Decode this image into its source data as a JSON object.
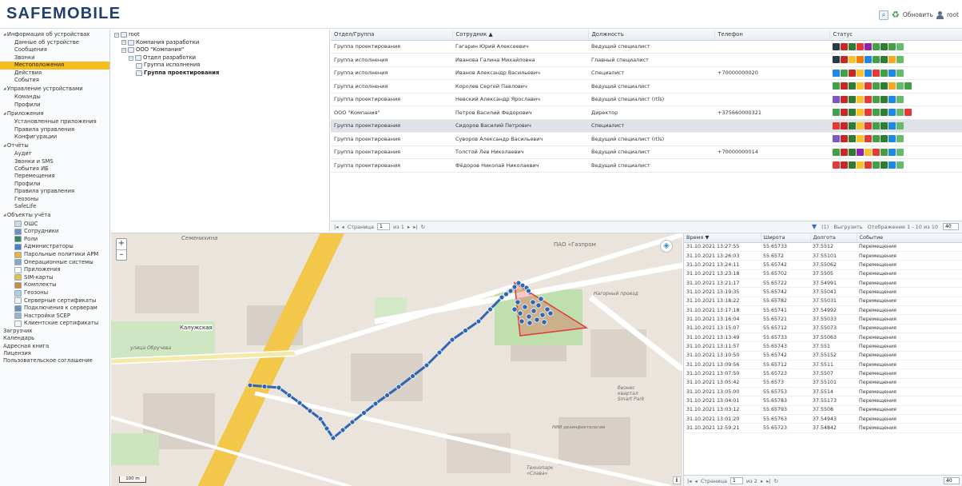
{
  "header": {
    "logo": "SAFEMOBILE",
    "refresh_label": "Обновить",
    "user": "root"
  },
  "sidebar": {
    "sections": [
      {
        "title": "Информация об устройствах",
        "items": [
          "Данные об устройстве",
          "Сообщения",
          "Звонки",
          "Местоположения",
          "Действия",
          "События"
        ],
        "active": "Местоположения"
      },
      {
        "title": "Управление устройствами",
        "items": [
          "Команды",
          "Профили"
        ]
      },
      {
        "title": "Приложения",
        "items": [
          "Установленные приложения",
          "Правила управления",
          "Конфигурации"
        ]
      },
      {
        "title": "Отчёты",
        "items": [
          "Аудит",
          "Звонки и SMS",
          "События ИБ",
          "Перемещения",
          "Профили",
          "Правила управления",
          "Геозоны",
          "SafeLife"
        ]
      },
      {
        "title": "Объекты учёта",
        "items": [
          "ОШС",
          "Сотрудники",
          "Роли",
          "Администраторы",
          "Парольные политики АРМ",
          "Операционные системы",
          "Приложения",
          "SIM-карты",
          "Комплекты",
          "Геозоны",
          "Серверные сертификаты",
          "Подключения к серверам",
          "Настройки SCEP",
          "Клиентские сертификаты"
        ]
      }
    ],
    "root_items": [
      "Загрузчик",
      "Календарь",
      "Адресная книга",
      "Лицензия",
      "Пользовательское соглашение"
    ]
  },
  "tree": {
    "nodes": [
      {
        "label": "root",
        "level": 0
      },
      {
        "label": "Компания разработки",
        "level": 1
      },
      {
        "label": "ООО \"Компания\"",
        "level": 1
      },
      {
        "label": "Отдел разработки",
        "level": 2
      },
      {
        "label": "Группа исполнения",
        "level": 3
      },
      {
        "label": "Группа проектирования",
        "level": 3,
        "bold": true
      }
    ]
  },
  "employees": {
    "columns": [
      "Отдел/Группа",
      "Сотрудник ▲",
      "Должность",
      "Телефон",
      "Статус"
    ],
    "rows": [
      {
        "group": "Группа проектирования",
        "name": "Гагарин Юрий Алексеевич",
        "position": "Ведущий специалист",
        "phone": "",
        "status": [
          "#2a3a4a",
          "#c62828",
          "#2e7d32",
          "#e53935",
          "#8e24aa",
          "#43a047",
          "#2e7d32",
          "#43a047",
          "#66bb6a"
        ]
      },
      {
        "group": "Группа исполнения",
        "name": "Иванова Галина Михайловна",
        "position": "Главный специалист",
        "phone": "",
        "status": [
          "#2a3a4a",
          "#c62828",
          "#fbc02d",
          "#f57c00",
          "#1e88e5",
          "#43a047",
          "#2e7d32",
          "#f9a825",
          "#66bb6a"
        ]
      },
      {
        "group": "Группа исполнения",
        "name": "Иванов Александр Васильевич",
        "position": "Специалист",
        "phone": "+70000000020",
        "status": [
          "#1e88e5",
          "#43a047",
          "#c62828",
          "#fbc02d",
          "#1e88e5",
          "#e53935",
          "#43a047",
          "#1e88e5",
          "#66bb6a"
        ]
      },
      {
        "group": "Группа исполнения",
        "name": "Королев Сергей Павлович",
        "position": "Ведущий специалист",
        "phone": "",
        "status": [
          "#43a047",
          "#c62828",
          "#2e7d32",
          "#fbc02d",
          "#e53935",
          "#43a047",
          "#2e7d32",
          "#f9a825",
          "#66bb6a",
          "#43a047"
        ]
      },
      {
        "group": "Группа проектирования",
        "name": "Невский Александр Ярославич",
        "position": "Ведущий специалист (rtls)",
        "phone": "",
        "status": [
          "#7e57c2",
          "#c62828",
          "#2e7d32",
          "#fbc02d",
          "#e53935",
          "#43a047",
          "#2e7d32",
          "#1e88e5",
          "#66bb6a"
        ]
      },
      {
        "group": "ООО \"Компания\"",
        "name": "Петров Василий Федорович",
        "position": "Директор",
        "phone": "+375660000321",
        "status": [
          "#43a047",
          "#c62828",
          "#2e7d32",
          "#fbc02d",
          "#e53935",
          "#43a047",
          "#2e7d32",
          "#1e88e5",
          "#66bb6a",
          "#e53935"
        ]
      },
      {
        "group": "Группа проектирования",
        "name": "Сидоров Василий Петрович",
        "position": "Специалист",
        "phone": "",
        "status": [
          "#e53935",
          "#c62828",
          "#2e7d32",
          "#fbc02d",
          "#e53935",
          "#43a047",
          "#2e7d32",
          "#1e88e5",
          "#66bb6a"
        ]
      },
      {
        "group": "Группа проектирования",
        "name": "Суворов Александр Васильевич",
        "position": "Ведущий специалист (rtls)",
        "phone": "",
        "status": [
          "#7e57c2",
          "#c62828",
          "#2e7d32",
          "#fbc02d",
          "#e53935",
          "#43a047",
          "#2e7d32",
          "#1e88e5",
          "#66bb6a"
        ]
      },
      {
        "group": "Группа проектирования",
        "name": "Толстой Лев Николаевич",
        "position": "Ведущий специалист",
        "phone": "+70000000014",
        "status": [
          "#43a047",
          "#c62828",
          "#2e7d32",
          "#8e24aa",
          "#fbc02d",
          "#e53935",
          "#43a047",
          "#1e88e5",
          "#66bb6a"
        ]
      },
      {
        "group": "Группа проектирования",
        "name": "Фёдоров Николай Николаевич",
        "position": "Ведущий специалист",
        "phone": "",
        "status": [
          "#e53935",
          "#c62828",
          "#2e7d32",
          "#fbc02d",
          "#e53935",
          "#43a047",
          "#2e7d32",
          "#1e88e5",
          "#66bb6a"
        ]
      }
    ],
    "selected_index": 6,
    "pager": {
      "page_label": "Страница",
      "page": "1",
      "of": "из 1",
      "filter": "(1)",
      "export": "Выгрузить",
      "display": "Отображение 1 - 10 из 10",
      "size": "40"
    }
  },
  "map": {
    "labels": [
      "Семенихина",
      "ПАО «Газпром",
      "Калужская",
      "улица Обручева",
      "Нагорный проезд",
      "бизнес квартал Smart Park",
      "НИИ дезинфектологии",
      "Технопарк «Слава»"
    ],
    "scale": "100 m",
    "info": "i",
    "route_color": "#2f66b3",
    "zone_color": "#e53935"
  },
  "events": {
    "columns": [
      "Время ▼",
      "Широта",
      "Долгота",
      "Событие"
    ],
    "rows": [
      [
        "31.10.2021 13:27:55",
        "55.65733",
        "37.5512",
        "Перемещения"
      ],
      [
        "31.10.2021 13:26:03",
        "55.6572",
        "37.55101",
        "Перемещения"
      ],
      [
        "31.10.2021 13:24:11",
        "55.65742",
        "37.55062",
        "Перемещения"
      ],
      [
        "31.10.2021 13:23:18",
        "55.65702",
        "37.5505",
        "Перемещения"
      ],
      [
        "31.10.2021 13:21:17",
        "55.65722",
        "37.54991",
        "Перемещения"
      ],
      [
        "31.10.2021 13:19:35",
        "55.65742",
        "37.55041",
        "Перемещения"
      ],
      [
        "31.10.2021 13:18:22",
        "55.65782",
        "37.55031",
        "Перемещения"
      ],
      [
        "31.10.2021 13:17:18",
        "55.65741",
        "37.54992",
        "Перемещения"
      ],
      [
        "31.10.2021 13:16:04",
        "55.65721",
        "37.55033",
        "Перемещения"
      ],
      [
        "31.10.2021 13:15:07",
        "55.65712",
        "37.55073",
        "Перемещения"
      ],
      [
        "31.10.2021 13:13:49",
        "55.65733",
        "37.55063",
        "Перемещения"
      ],
      [
        "31.10.2021 13:11:57",
        "55.65743",
        "37.551",
        "Перемещения"
      ],
      [
        "31.10.2021 13:10:50",
        "55.65742",
        "37.55152",
        "Перемещения"
      ],
      [
        "31.10.2021 13:09:56",
        "55.65712",
        "37.5511",
        "Перемещения"
      ],
      [
        "31.10.2021 13:07:50",
        "55.65723",
        "37.5507",
        "Перемещения"
      ],
      [
        "31.10.2021 13:05:42",
        "55.6573",
        "37.55101",
        "Перемещения"
      ],
      [
        "31.10.2021 13:05:00",
        "55.65753",
        "37.5514",
        "Перемещения"
      ],
      [
        "31.10.2021 13:04:01",
        "55.65783",
        "37.55173",
        "Перемещения"
      ],
      [
        "31.10.2021 13:03:12",
        "55.65793",
        "37.5508",
        "Перемещения"
      ],
      [
        "31.10.2021 13:01:20",
        "55.65763",
        "37.54943",
        "Перемещения"
      ],
      [
        "31.10.2021 12:59:21",
        "55.65723",
        "37.54842",
        "Перемещения"
      ]
    ],
    "pager": {
      "page_label": "Страница",
      "page": "1",
      "of": "из 2",
      "size": "40"
    }
  }
}
